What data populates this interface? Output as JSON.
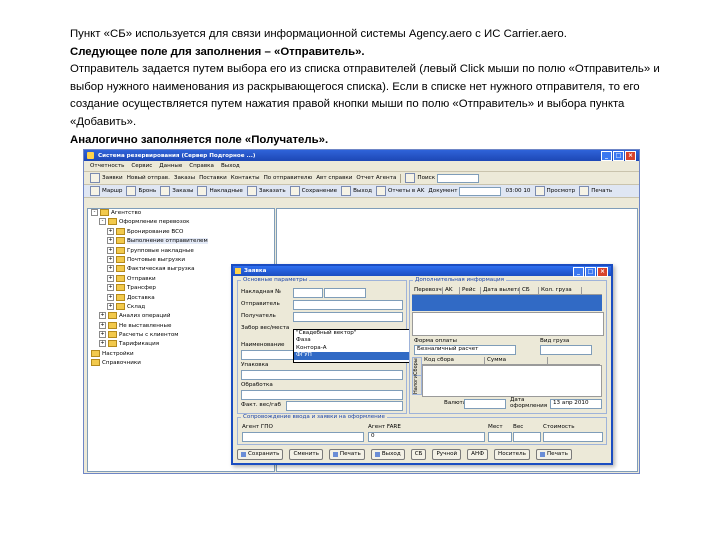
{
  "text": {
    "line1": "Пункт «СБ» используется для связи информационной системы Agency.aero с ИС Carrier.aero.",
    "line2": "Следующее поле для заполнения – «Отправитель».",
    "line3": "Отправитель задается путем выбора его из списка отправителей (левый Click мыши по полю «Отправитель» и выбор нужного наименования из раскрывающегося списка). Если в списке нет нужного отправителя, то его создание осуществляется путем нажатия правой кнопки мыши по полю «Отправитель» и выбора пункта «Добавить».",
    "line4": "Аналогично заполняется поле «Получатель»."
  },
  "app": {
    "window_title": "Система резервирования (Сервер Подгорное ...)",
    "menu": [
      "Отчетность",
      "Сервис",
      "Данные",
      "Справка",
      "Выход"
    ],
    "toolbar1": {
      "items": [
        "Заявки",
        "Новый отправ.",
        "Заказы",
        "Поставки",
        "Контакты",
        "По отправителю",
        "Авт справки",
        "Отчет Агента"
      ],
      "search_label": "Поиск",
      "search_value": ""
    },
    "toolbar2": {
      "items": [
        "Маршр",
        "Бронь",
        "Заказы",
        "Накладные",
        "Заказать",
        "Сохранение",
        "Выход",
        "Отчеты в AK"
      ],
      "field_label": "Документ",
      "time_value": "03:00 10",
      "preview_label": "Просмотр",
      "print_label": "Печать"
    },
    "tree": [
      {
        "label": "Агентство",
        "level": 0,
        "pm": "-"
      },
      {
        "label": "Оформление перевозок",
        "level": 1,
        "pm": "-"
      },
      {
        "label": "Бронирование ВСО",
        "level": 2,
        "pm": "+"
      },
      {
        "label": "Выполнение отправителем",
        "level": 2,
        "pm": "+",
        "selected": true
      },
      {
        "label": "Групповые накладные",
        "level": 2,
        "pm": "+"
      },
      {
        "label": "Почтовые выгрузки",
        "level": 2,
        "pm": "+"
      },
      {
        "label": "Фактическая выгрузка",
        "level": 2,
        "pm": "+"
      },
      {
        "label": "Отправки",
        "level": 2,
        "pm": "+"
      },
      {
        "label": "Трансфер",
        "level": 2,
        "pm": "+"
      },
      {
        "label": "Доставка",
        "level": 2,
        "pm": "+"
      },
      {
        "label": "Склад",
        "level": 2,
        "pm": "+"
      },
      {
        "label": "Анализ операций",
        "level": 1,
        "pm": "+"
      },
      {
        "label": "Не выставленные",
        "level": 1,
        "pm": "+"
      },
      {
        "label": "Расчеты с клиентом",
        "level": 1,
        "pm": "+"
      },
      {
        "label": "Тарификация",
        "level": 1,
        "pm": "+"
      },
      {
        "label": "Настройки",
        "level": 0,
        "pm": ""
      },
      {
        "label": "Справочники",
        "level": 0,
        "pm": ""
      }
    ],
    "dialog": {
      "title": "Заявка",
      "group_main": "Основные параметры",
      "group_extra": "Дополнительная информация",
      "labels": {
        "waybill": "Накладная №",
        "sender": "Отправитель",
        "receiver": "Получатель",
        "pickup": "Забор вес/места",
        "place": "Наименование",
        "packing": "Упаковка",
        "processing": "Обработка",
        "fact_weight": "Факт. вес/габ",
        "payment_form": "Форма оплаты",
        "cargo_group": "Вид груза",
        "currency": "Валюта",
        "date_label": "Дата оформления",
        "agent": "Агент ГПО",
        "agent_fare": "Агент FARE",
        "places": "Мест",
        "weight": "Вес",
        "cost": "Стоимость",
        "group_bottom": "Сопровождение ввода и заявки на оформление"
      },
      "payment_value": "Безналичный расчет",
      "date_value": "13 апр 2010",
      "agent_fare_value": "0",
      "sender_dropdown": [
        "\"Свадебный вектор\"",
        "Фаза",
        "Контора-А",
        "ФГУП"
      ],
      "sender_highlight_index": 3,
      "grid_columns": [
        "Перевозчик",
        "AK",
        "Рейс",
        "Дата вылета",
        "СБ",
        "Кол. груза"
      ],
      "fees_columns": [
        "Код сбора",
        "Сумма"
      ],
      "vtabs": [
        "Сборы",
        "Налоги"
      ],
      "footer": [
        "Сохранить",
        "Сменить",
        "Печать",
        "Выход",
        "СБ",
        "Ручной",
        "АНФ",
        "Носитель",
        "Печать"
      ]
    }
  }
}
